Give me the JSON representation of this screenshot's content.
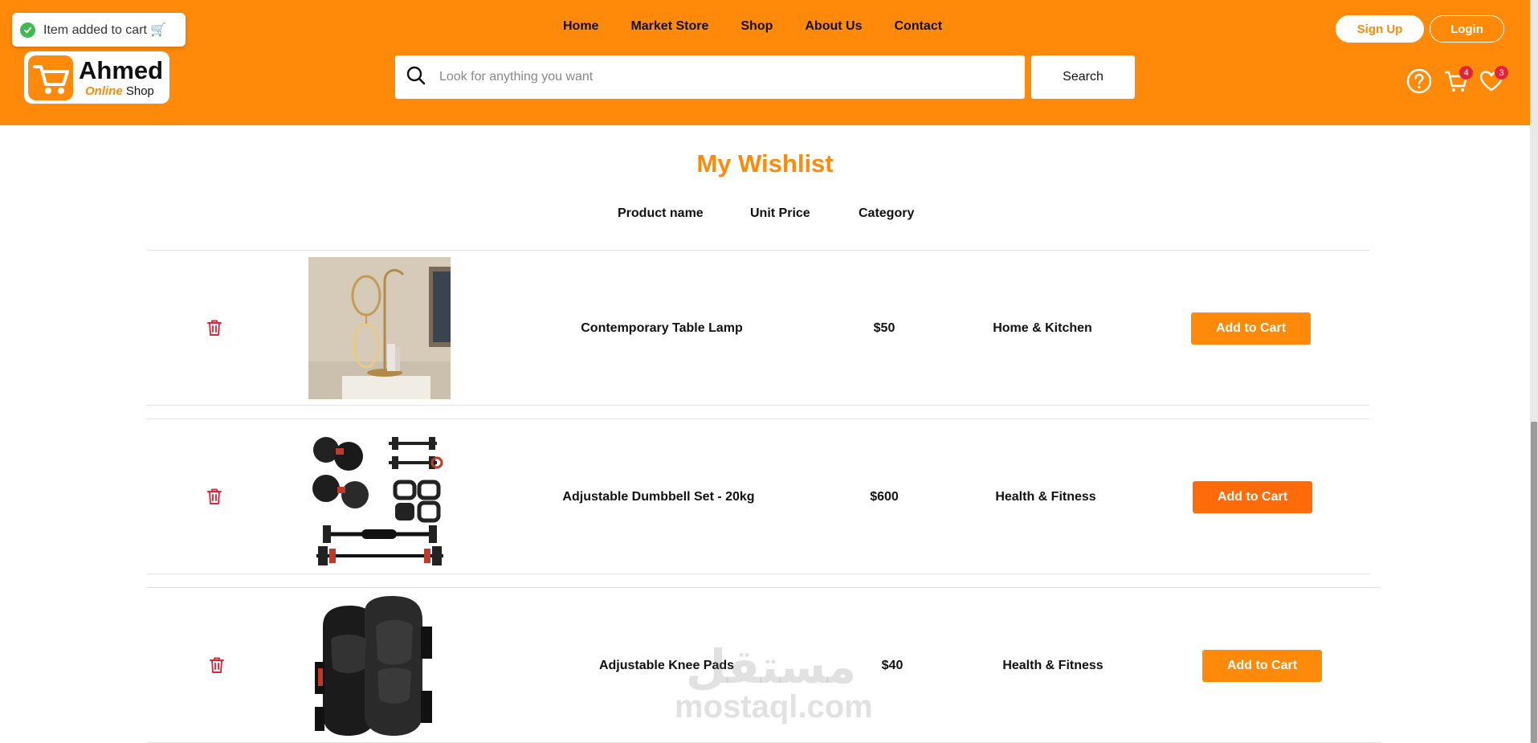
{
  "toast": {
    "text": "Item added to cart 🛒"
  },
  "logo": {
    "name": "Ahmed",
    "sub_a": "Online",
    "sub_b": "Shop"
  },
  "nav": {
    "home": "Home",
    "market_store": "Market Store",
    "shop": "Shop",
    "about": "About Us",
    "contact": "Contact"
  },
  "auth": {
    "signup": "Sign Up",
    "login": "Login"
  },
  "search": {
    "placeholder": "Look for anything you want",
    "button": "Search"
  },
  "header_icons": {
    "cart_count": "4",
    "wishlist_count": "3"
  },
  "page": {
    "title": "My Wishlist"
  },
  "columns": {
    "product": "Product name",
    "price": "Unit Price",
    "category": "Category"
  },
  "wishlist": [
    {
      "name": "Contemporary Table Lamp",
      "price": "$50",
      "category": "Home & Kitchen",
      "action": "Add to Cart"
    },
    {
      "name": "Adjustable Dumbbell Set - 20kg",
      "price": "$600",
      "category": "Health & Fitness",
      "action": "Add to Cart"
    },
    {
      "name": "Adjustable Knee Pads",
      "price": "$40",
      "category": "Health & Fitness",
      "action": "Add to Cart"
    }
  ],
  "watermark": {
    "arabic": "مستقل",
    "latin": "mostaql.com"
  },
  "colors": {
    "brand": "#ff8a0a",
    "badge": "#e0253a",
    "trash": "#e0253a",
    "success": "#3fb950"
  }
}
